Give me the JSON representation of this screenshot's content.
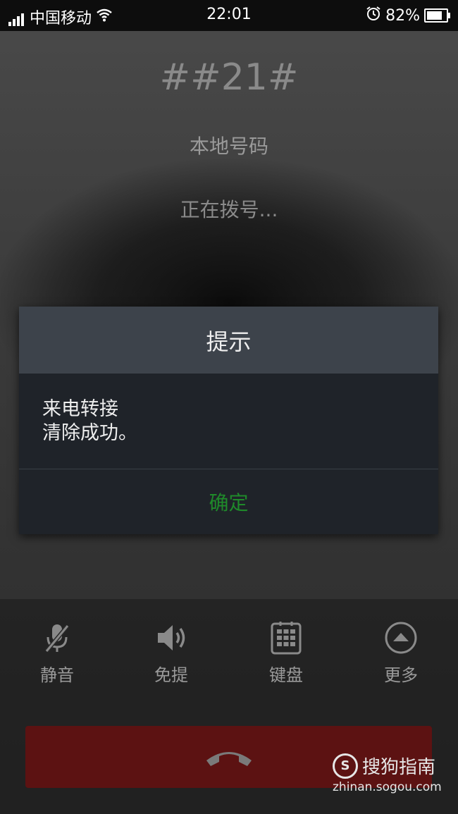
{
  "status_bar": {
    "carrier": "中国移动",
    "time": "22:01",
    "battery": "82%",
    "battery_level": 0.82,
    "icons": [
      "signal-icon",
      "wifi-icon",
      "alarm-icon",
      "battery-icon"
    ]
  },
  "call": {
    "number": "##21#",
    "location": "本地号码",
    "status": "正在拨号..."
  },
  "dialog": {
    "title": "提示",
    "message_line1": "来电转接",
    "message_line2": "清除成功。",
    "ok_label": "确定",
    "ok_color": "#1f8a2a"
  },
  "controls": {
    "mute": "静音",
    "speaker": "免提",
    "keypad": "键盘",
    "more": "更多"
  },
  "end_call": {
    "icon": "hangup-icon",
    "color": "#5c1212"
  },
  "watermark": {
    "brand": "搜狗指南",
    "url": "zhinan.sogou.com"
  }
}
